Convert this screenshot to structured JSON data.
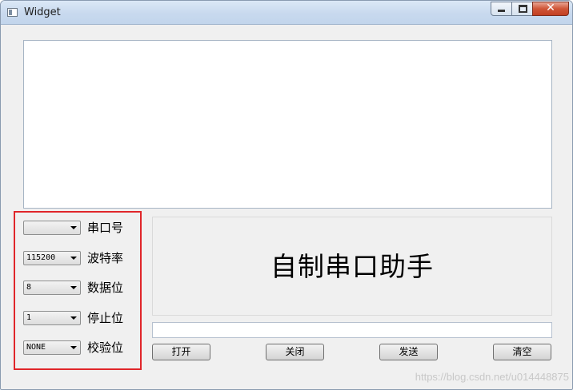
{
  "window": {
    "title": "Widget",
    "icons": {
      "app": "window-app-icon",
      "minimize": "minimize-icon",
      "maximize": "maximize-icon",
      "close": "close-icon"
    },
    "close_glyph": "✕"
  },
  "receive_area": {
    "value": ""
  },
  "settings": {
    "rows": [
      {
        "value": "",
        "label": "串口号"
      },
      {
        "value": "115200",
        "label": "波特率"
      },
      {
        "value": "8",
        "label": "数据位"
      },
      {
        "value": "1",
        "label": "停止位"
      },
      {
        "value": "NONE",
        "label": "校验位"
      }
    ],
    "highlight_color": "#e0262a"
  },
  "banner": {
    "title": "自制串口助手"
  },
  "send_input": {
    "value": ""
  },
  "buttons": {
    "open": "打开",
    "close": "关闭",
    "send": "发送",
    "clear": "清空"
  },
  "watermark": "https://blog.csdn.net/u014448875"
}
